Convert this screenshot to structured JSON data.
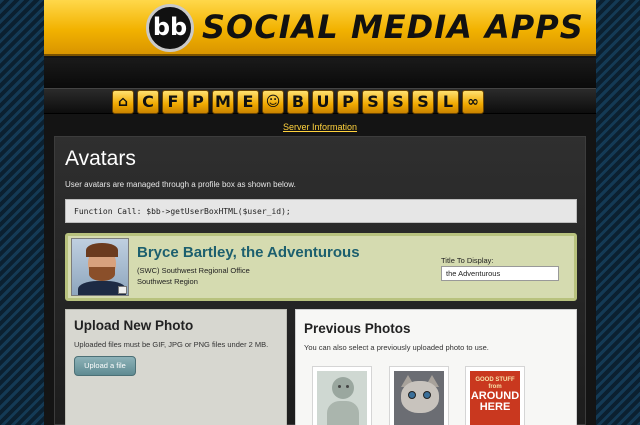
{
  "header": {
    "logo_text": "bb",
    "title": "SOCIAL MEDIA APPS"
  },
  "nav": {
    "items": [
      {
        "label": "",
        "icon": "home-icon"
      },
      {
        "label": "C"
      },
      {
        "label": "F"
      },
      {
        "label": "P"
      },
      {
        "label": "M"
      },
      {
        "label": "E"
      },
      {
        "label": "",
        "icon": "smiley-avatar-icon"
      },
      {
        "label": "B"
      },
      {
        "label": "U"
      },
      {
        "label": "P"
      },
      {
        "label": "S"
      },
      {
        "label": "S"
      },
      {
        "label": "S"
      },
      {
        "label": "L"
      },
      {
        "label": "",
        "icon": "link-icon"
      }
    ],
    "server_link": "Server Information"
  },
  "main": {
    "title": "Avatars",
    "intro": "User avatars are managed through a profile box as shown below.",
    "code": "Function Call: $bb->getUserBoxHTML($user_id);"
  },
  "profile": {
    "name": "Bryce Bartley, the Adventurous",
    "office": "(SWC) Southwest Regional Office",
    "region": "Southwest Region",
    "title_label": "Title To Display:",
    "title_value": "the Adventurous"
  },
  "upload": {
    "title": "Upload New Photo",
    "hint": "Uploaded files must be GIF, JPG or PNG files under 2 MB.",
    "button_label": "Upload a file"
  },
  "previous": {
    "title": "Previous Photos",
    "hint": "You can also select a previously uploaded photo to use.",
    "thumb3_small_top": "GOOD STUFF from",
    "thumb3_big": "AROUND HERE"
  },
  "colors": {
    "banner_gold": "#f2b200",
    "profile_bg": "#d5dbb0",
    "name_teal": "#1c5f6e",
    "link_yellow": "#ffd23d"
  }
}
